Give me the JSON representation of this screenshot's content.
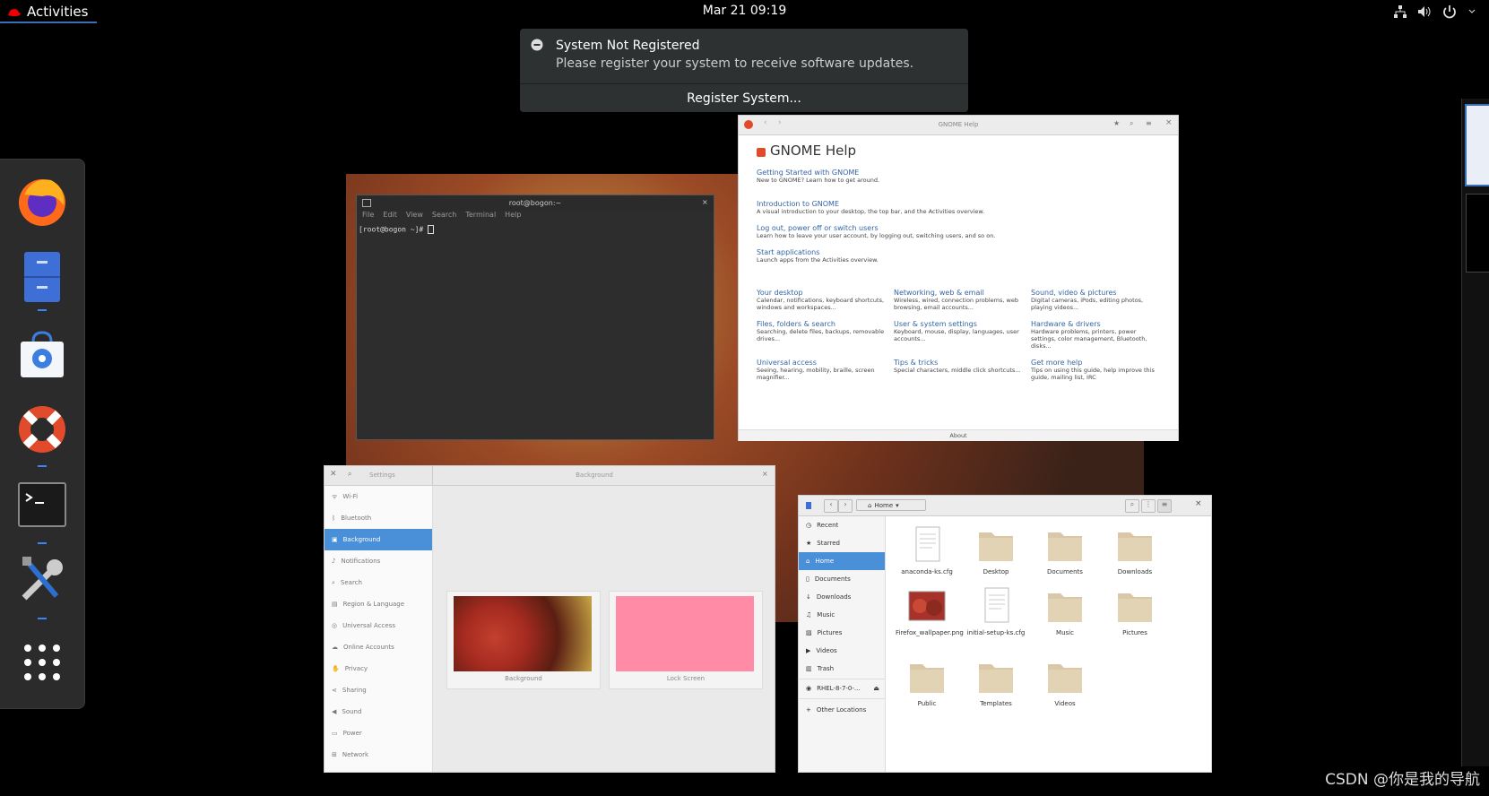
{
  "topbar": {
    "activities": "Activities",
    "clock": "Mar 21  09:19"
  },
  "notification": {
    "title": "System Not Registered",
    "body": "Please register your system to receive software updates.",
    "button": "Register System..."
  },
  "terminal": {
    "title": "root@bogon:~",
    "menu": [
      "File",
      "Edit",
      "View",
      "Search",
      "Terminal",
      "Help"
    ],
    "prompt": "[root@bogon ~]# "
  },
  "help": {
    "window_title": "GNOME Help",
    "heading": "GNOME Help",
    "topics": [
      {
        "title": "Getting Started with GNOME",
        "desc": "New to GNOME? Learn how to get around."
      },
      {
        "title": "Introduction to GNOME",
        "desc": "A visual introduction to your desktop, the top bar, and the Activities overview."
      },
      {
        "title": "Log out, power off or switch users",
        "desc": "Learn how to leave your user account, by logging out, switching users, and so on."
      },
      {
        "title": "Start applications",
        "desc": "Launch apps from the Activities overview."
      }
    ],
    "grid": [
      {
        "title": "Your desktop",
        "desc": "Calendar, notifications, keyboard shortcuts, windows and workspaces..."
      },
      {
        "title": "Networking, web & email",
        "desc": "Wireless, wired, connection problems, web browsing, email accounts..."
      },
      {
        "title": "Sound, video & pictures",
        "desc": "Digital cameras, iPods, editing photos, playing videos..."
      },
      {
        "title": "Files, folders & search",
        "desc": "Searching, delete files, backups, removable drives..."
      },
      {
        "title": "User & system settings",
        "desc": "Keyboard, mouse, display, languages, user accounts..."
      },
      {
        "title": "Hardware & drivers",
        "desc": "Hardware problems, printers, power settings, color management, Bluetooth, disks..."
      },
      {
        "title": "Universal access",
        "desc": "Seeing, hearing, mobility, braille, screen magnifier..."
      },
      {
        "title": "Tips & tricks",
        "desc": "Special characters, middle click shortcuts..."
      },
      {
        "title": "Get more help",
        "desc": "Tips on using this guide, help improve this guide, mailing list, IRC"
      }
    ],
    "footer": "About"
  },
  "settings": {
    "app_title": "Settings",
    "panel_title": "Background",
    "items": [
      "Wi-Fi",
      "Bluetooth",
      "Background",
      "Notifications",
      "Search",
      "Region & Language",
      "Universal Access",
      "Online Accounts",
      "Privacy",
      "Sharing",
      "Sound",
      "Power",
      "Network"
    ],
    "previews": [
      "Background",
      "Lock Screen"
    ],
    "lock_color": "#ff8ba6"
  },
  "files": {
    "location": "Home",
    "sidebar": [
      "Recent",
      "Starred",
      "Home",
      "Documents",
      "Downloads",
      "Music",
      "Pictures",
      "Videos",
      "Trash",
      "RHEL-8-7-0-...",
      "Other Locations"
    ],
    "icons": [
      "anaconda-ks.cfg",
      "Desktop",
      "Documents",
      "Downloads",
      "Firefox_wallpaper.png",
      "initial-setup-ks.cfg",
      "Music",
      "Pictures",
      "Public",
      "Templates",
      "Videos"
    ]
  },
  "watermark": "CSDN @你是我的导航"
}
